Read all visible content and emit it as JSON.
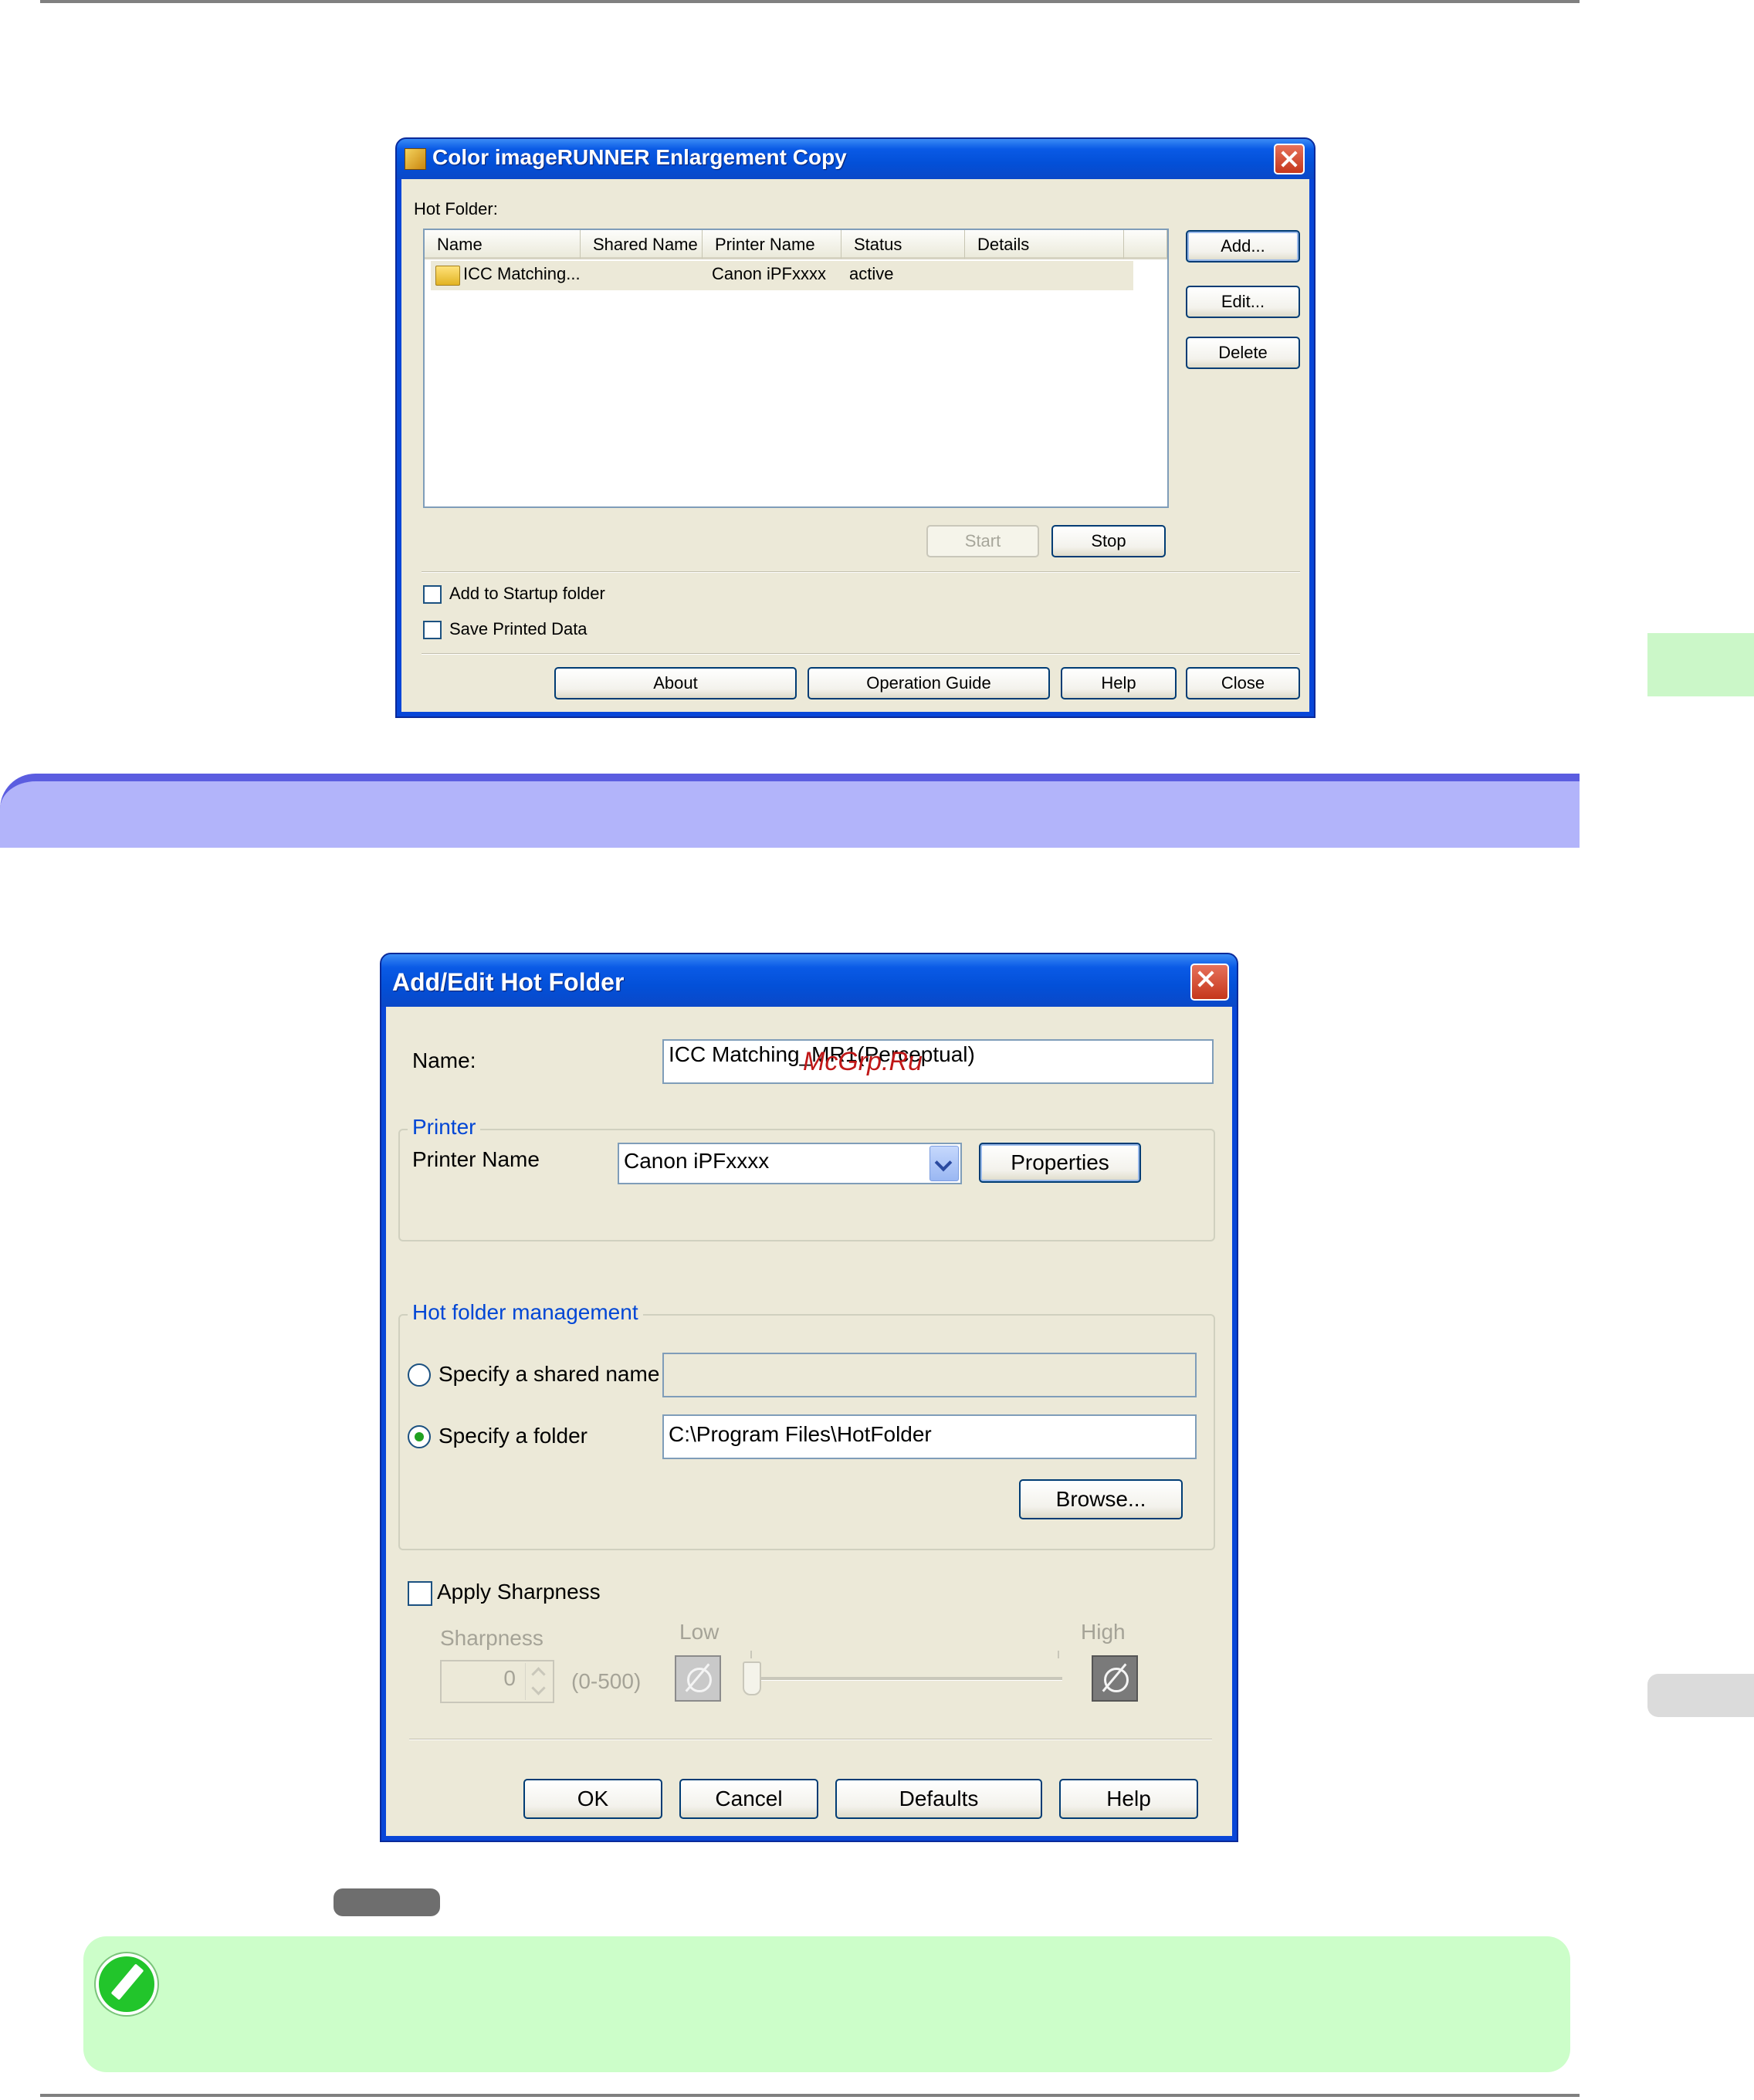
{
  "win1": {
    "title": "Color imageRUNNER Enlargement Copy",
    "hot_folder_label": "Hot Folder:",
    "columns": [
      "Name",
      "Shared Name",
      "Printer Name",
      "Status",
      "Details"
    ],
    "rows": [
      {
        "name": "ICC Matching...",
        "shared": "",
        "printer": "Canon iPFxxxx",
        "status": "active",
        "details": ""
      }
    ],
    "buttons": {
      "add": "Add...",
      "edit": "Edit...",
      "delete": "Delete",
      "start": "Start",
      "stop": "Stop",
      "about": "About",
      "guide": "Operation Guide",
      "help": "Help",
      "close": "Close"
    },
    "checkboxes": {
      "startup": "Add to Startup folder",
      "save": "Save Printed Data"
    }
  },
  "win2": {
    "title": "Add/Edit Hot Folder",
    "name_label": "Name:",
    "name_value": "ICC Matching_MR1(Perceptual)",
    "watermark": "McGrp.Ru",
    "printer_group": "Printer",
    "printer_name_label": "Printer Name",
    "printer_value": "Canon iPFxxxx",
    "properties": "Properties",
    "mgmt_group": "Hot folder management",
    "radio_shared": "Specify a shared name",
    "radio_folder": "Specify a folder",
    "shared_value": "",
    "folder_value": "C:\\Program Files\\HotFolder",
    "browse": "Browse...",
    "apply_sharpness": "Apply Sharpness",
    "sharpness_label": "Sharpness",
    "sharpness_value": "0",
    "sharpness_range": "(0-500)",
    "low": "Low",
    "high": "High",
    "buttons": {
      "ok": "OK",
      "cancel": "Cancel",
      "defaults": "Defaults",
      "help": "Help"
    }
  }
}
